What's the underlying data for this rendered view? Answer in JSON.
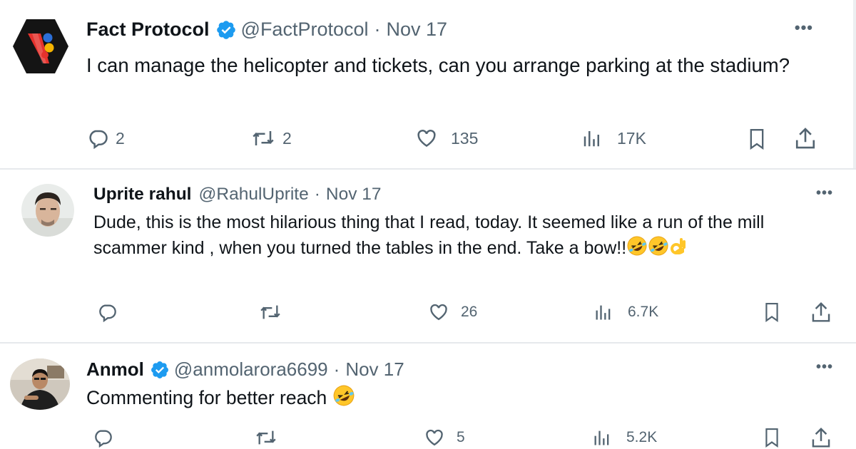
{
  "tweets": [
    {
      "author_name": "Fact Protocol",
      "verified": true,
      "handle": "@FactProtocol",
      "separator": "·",
      "date": "Nov 17",
      "text": "I can manage the helicopter and tickets, can you arrange parking at the stadium?",
      "replies": "2",
      "reposts": "2",
      "likes": "135",
      "views": "17K",
      "more": "•••"
    },
    {
      "author_name": "Uprite rahul",
      "verified": false,
      "handle": "@RahulUprite",
      "separator": "·",
      "date": "Nov 17",
      "text": "Dude, this is the most hilarious thing that I read, today. It seemed like a run of the mill scammer kind , when you turned the tables in the end. Take a bow!!",
      "emojis": [
        "rolling-on-floor-laughing-icon",
        "rolling-on-floor-laughing-icon",
        "ok-hand-icon"
      ],
      "replies": "",
      "reposts": "",
      "likes": "26",
      "views": "6.7K",
      "more": "•••"
    },
    {
      "author_name": "Anmol",
      "verified": true,
      "handle": "@anmolarora6699",
      "separator": "·",
      "date": "Nov 17",
      "text": "Commenting for better reach",
      "emojis": [
        "rolling-on-floor-laughing-icon"
      ],
      "replies": "",
      "reposts": "",
      "likes": "5",
      "views": "5.2K",
      "more": "•••"
    }
  ],
  "colors": {
    "text": "#0f1419",
    "secondary": "#536471",
    "verified_blue": "#1d9bf0",
    "divider": "#e6e9ec"
  }
}
